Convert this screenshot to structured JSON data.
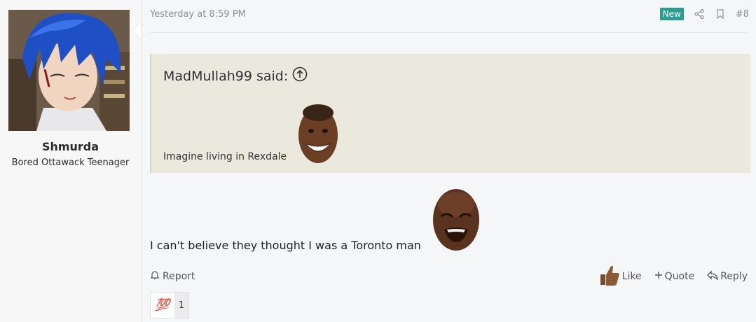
{
  "user": {
    "name": "Shmurda",
    "title": "Bored Ottawack Teenager"
  },
  "post": {
    "date": "Yesterday at 8:59 PM",
    "badge": "New",
    "number": "#8",
    "quote": {
      "author": "MadMullah99 said:",
      "text": "Imagine living in Rexdale"
    },
    "body": "I can't believe they thought I was a Toronto man"
  },
  "footer": {
    "report": "Report",
    "like": "Like",
    "quote": "Quote",
    "reply": "Reply"
  },
  "reactions": [
    {
      "emoji": "💯",
      "count": "1"
    }
  ],
  "colors": {
    "badge": "#2a9d8f",
    "quote_bg": "#ebe8dd",
    "muted": "#8d8f94"
  }
}
